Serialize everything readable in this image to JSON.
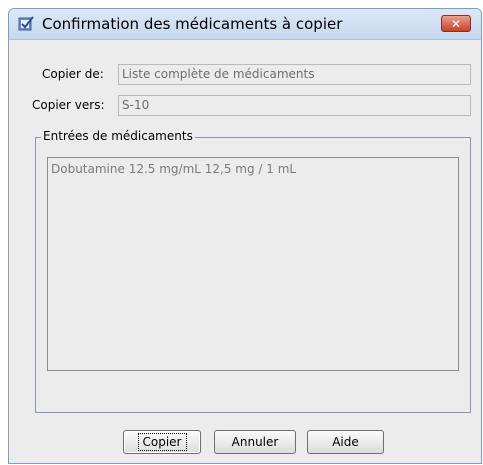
{
  "window": {
    "title": "Confirmation des médicaments à copier",
    "close_glyph": "✕"
  },
  "form": {
    "copy_from_label": "Copier de:",
    "copy_from_value": "Liste complète de médicaments",
    "copy_to_label": "Copier vers:",
    "copy_to_value": "S-10"
  },
  "entries": {
    "legend": "Entrées de médicaments",
    "items": [
      "Dobutamine 12.5 mg/mL 12,5 mg / 1 mL"
    ]
  },
  "buttons": {
    "copy": "Copier",
    "cancel": "Annuler",
    "help": "Aide"
  },
  "colors": {
    "titlebar": "#c7d9ee",
    "close": "#c7422a",
    "background": "#ececec"
  },
  "icons": {
    "app": "checkbox-icon",
    "close": "close-icon"
  }
}
